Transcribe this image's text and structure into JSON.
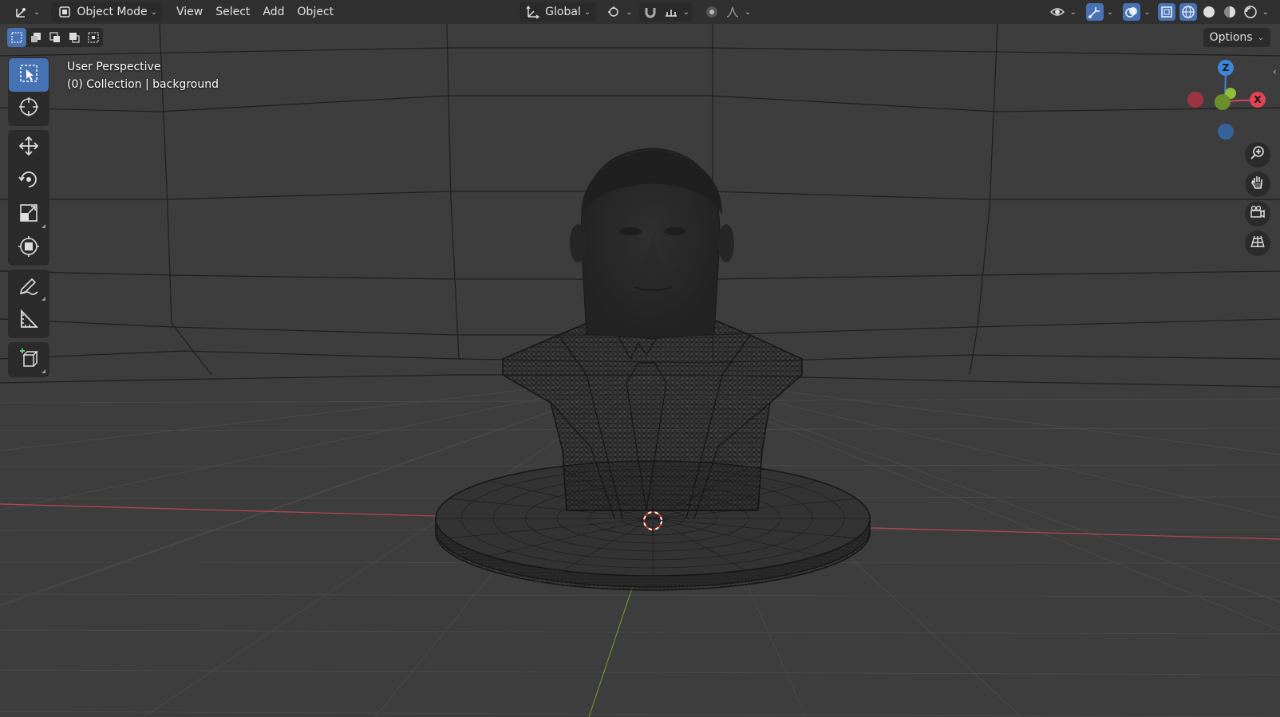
{
  "header": {
    "editor_type_icon": "3d-viewport-icon",
    "mode": {
      "label": "Object Mode",
      "icon": "object-mode-icon"
    },
    "menus": [
      "View",
      "Select",
      "Add",
      "Object"
    ],
    "transform_orientation": {
      "label": "Global",
      "icon": "orientation-axes-icon"
    },
    "pivot_icon": "pivot-point-icon",
    "snap_icon": "magnet-snap-icon",
    "snap_target_icon": "snap-increment-icon",
    "proportional_icon": "proportional-editing-icon",
    "falloff_icon": "falloff-curve-icon",
    "visibility_icon": "object-visibility-icon",
    "gizmo_icon": "gizmo-toggle-icon",
    "overlay_icon": "overlays-icon",
    "xray_icon": "xray-toggle-icon",
    "shading_modes": [
      "wireframe",
      "solid",
      "material-preview",
      "rendered"
    ],
    "active_shading": "wireframe"
  },
  "select_modes": [
    "select-new-icon",
    "select-extend-icon",
    "select-subtract-icon",
    "select-invert-icon",
    "select-intersect-icon"
  ],
  "options": {
    "label": "Options"
  },
  "viewport": {
    "view_name": "User Perspective",
    "collection": "(0) Collection",
    "active_object": "background"
  },
  "toolbar": {
    "tools": [
      "select-box-icon",
      "cursor-icon",
      "move-icon",
      "rotate-icon",
      "scale-icon",
      "transform-icon",
      "annotate-icon",
      "measure-icon",
      "add-cube-icon"
    ],
    "active": "select-box-icon"
  },
  "gizmo": {
    "axes": {
      "x": "X",
      "y": "",
      "z": "Z"
    },
    "colors": {
      "x": "#e04456",
      "y": "#8dbd39",
      "z": "#3d86db",
      "neg_x": "#9e3440",
      "neg_z": "#35649c"
    }
  },
  "nav_buttons": [
    "zoom-icon",
    "pan-hand-icon",
    "camera-view-icon",
    "ortho-grid-icon"
  ],
  "colors": {
    "header_bg": "#303030",
    "viewport_bg": "#3d3d3d",
    "accent": "#4772b3",
    "x_axis_line": "#b74556",
    "y_axis_line": "#6e8f2c"
  }
}
